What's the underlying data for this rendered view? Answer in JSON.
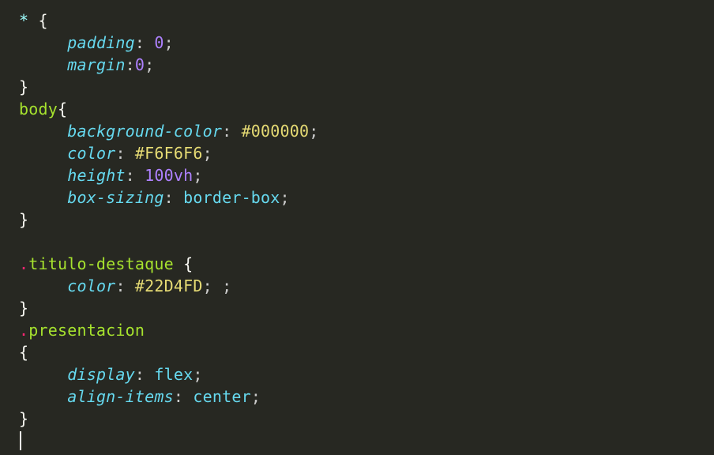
{
  "code": {
    "lines": [
      {
        "i": 0,
        "t": "sel",
        "text": "*"
      },
      {
        "i": 0,
        "t": "brace_open",
        "text": " {"
      },
      {
        "i": 1,
        "t": "prop",
        "text": "padding"
      },
      {
        "i": 1,
        "t": "colon",
        "text": ": "
      },
      {
        "i": 1,
        "t": "num",
        "text": "0"
      },
      {
        "i": 1,
        "t": "semi",
        "text": ";"
      },
      {
        "i": 2,
        "t": "prop",
        "text": "margin"
      },
      {
        "i": 2,
        "t": "colon",
        "text": ":"
      },
      {
        "i": 2,
        "t": "num",
        "text": "0"
      },
      {
        "i": 2,
        "t": "semi",
        "text": ";"
      },
      {
        "i": 3,
        "t": "brace_close",
        "text": "}"
      },
      {
        "i": 4,
        "t": "sel",
        "text": "body"
      },
      {
        "i": 4,
        "t": "brace_open",
        "text": "{"
      },
      {
        "i": 5,
        "t": "prop",
        "text": "background-color"
      },
      {
        "i": 5,
        "t": "colon",
        "text": ": "
      },
      {
        "i": 5,
        "t": "hex",
        "text": "#000000"
      },
      {
        "i": 5,
        "t": "semi",
        "text": ";"
      },
      {
        "i": 6,
        "t": "prop",
        "text": "color"
      },
      {
        "i": 6,
        "t": "colon",
        "text": ": "
      },
      {
        "i": 6,
        "t": "hex",
        "text": "#F6F6F6"
      },
      {
        "i": 6,
        "t": "semi",
        "text": ";"
      },
      {
        "i": 7,
        "t": "prop",
        "text": "height"
      },
      {
        "i": 7,
        "t": "colon",
        "text": ": "
      },
      {
        "i": 7,
        "t": "num",
        "text": "100vh"
      },
      {
        "i": 7,
        "t": "semi",
        "text": ";"
      },
      {
        "i": 8,
        "t": "prop",
        "text": "box-sizing"
      },
      {
        "i": 8,
        "t": "colon",
        "text": ": "
      },
      {
        "i": 8,
        "t": "val",
        "text": "border-box"
      },
      {
        "i": 8,
        "t": "semi",
        "text": ";"
      },
      {
        "i": 9,
        "t": "brace_close",
        "text": "}"
      },
      {
        "i": 10,
        "t": "blank",
        "text": ""
      },
      {
        "i": 11,
        "t": "dot",
        "text": "."
      },
      {
        "i": 11,
        "t": "sel",
        "text": "titulo-destaque"
      },
      {
        "i": 11,
        "t": "brace_open",
        "text": " {"
      },
      {
        "i": 12,
        "t": "prop",
        "text": "color"
      },
      {
        "i": 12,
        "t": "colon",
        "text": ": "
      },
      {
        "i": 12,
        "t": "hex",
        "text": "#22D4FD"
      },
      {
        "i": 12,
        "t": "semi",
        "text": "; ;"
      },
      {
        "i": 13,
        "t": "brace_close",
        "text": "}"
      },
      {
        "i": 14,
        "t": "dot",
        "text": "."
      },
      {
        "i": 14,
        "t": "sel",
        "text": "presentacion"
      },
      {
        "i": 15,
        "t": "brace_open",
        "text": "{"
      },
      {
        "i": 16,
        "t": "prop",
        "text": "display"
      },
      {
        "i": 16,
        "t": "colon",
        "text": ": "
      },
      {
        "i": 16,
        "t": "val",
        "text": "flex"
      },
      {
        "i": 16,
        "t": "semi",
        "text": ";"
      },
      {
        "i": 17,
        "t": "prop",
        "text": "align-items"
      },
      {
        "i": 17,
        "t": "colon",
        "text": ": "
      },
      {
        "i": 17,
        "t": "val",
        "text": "center"
      },
      {
        "i": 17,
        "t": "semi",
        "text": ";"
      },
      {
        "i": 18,
        "t": "brace_close",
        "text": "}"
      }
    ],
    "indent": "     ",
    "rules": [
      {
        "selector": "*",
        "props": {
          "padding": "0",
          "margin": "0"
        }
      },
      {
        "selector": "body",
        "props": {
          "background-color": "#000000",
          "color": "#F6F6F6",
          "height": "100vh",
          "box-sizing": "border-box"
        }
      },
      {
        "selector": ".titulo-destaque",
        "props": {
          "color": "#22D4FD"
        }
      },
      {
        "selector": ".presentacion",
        "props": {
          "display": "flex",
          "align-items": "center"
        }
      }
    ]
  }
}
